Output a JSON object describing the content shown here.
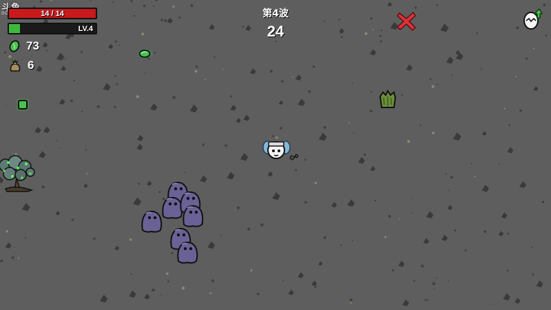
{
  "watermark": {
    "main": "斗鱼",
    "sub": "DOUYU.COM"
  },
  "hud": {
    "hp_text": "14 / 14",
    "hp_fraction": 1.0,
    "level_text": "LV.4",
    "xp_fraction": 0.13,
    "materials": "73",
    "bag_count": "6",
    "wave_label": "第4波",
    "timer": "24"
  },
  "icons": {
    "materials": "green-material-icon",
    "bag": "bag-icon",
    "cancel": "red-x-icon",
    "upgrade": "egg-upgrade-icon"
  },
  "colors": {
    "ground": "#5e5e5e",
    "hp": "#c8191c",
    "xp": "#3dba3d",
    "enemy": "#6a6296",
    "material": "#4cc24c",
    "cancel": "#d9333b"
  }
}
